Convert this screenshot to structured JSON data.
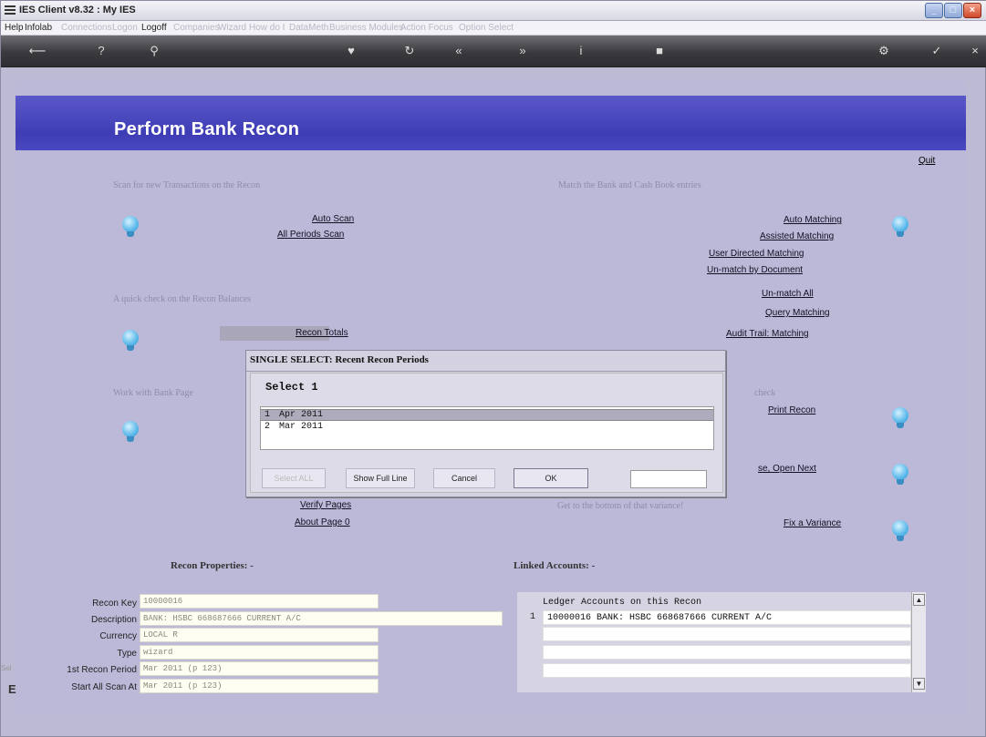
{
  "window": {
    "title": "IES Client v8.32 : My IES",
    "controls": {
      "minimize": "_",
      "maximize": "□",
      "close": "×"
    }
  },
  "menu": {
    "items": [
      {
        "label": "Help",
        "enabled": true
      },
      {
        "label": "Infolab",
        "enabled": true
      },
      {
        "label": "Connections",
        "enabled": false
      },
      {
        "label": "Logon",
        "enabled": false
      },
      {
        "label": "Logoff",
        "enabled": true
      },
      {
        "label": "Companies",
        "enabled": false
      },
      {
        "label": "Wizard",
        "enabled": false
      },
      {
        "label": "How do I",
        "enabled": false
      },
      {
        "label": "DataMeth",
        "enabled": false
      },
      {
        "label": "Business Modules",
        "enabled": false
      },
      {
        "label": "Action Focus",
        "enabled": false
      },
      {
        "label": "Option Select",
        "enabled": false
      }
    ]
  },
  "toolbar": {
    "icons": [
      "back-icon",
      "help-icon",
      "search-icon",
      "heart-icon",
      "refresh-icon",
      "rewind-icon",
      "forward-icon",
      "info-icon",
      "stop-icon",
      "settings-icon",
      "check-icon",
      "close-icon"
    ]
  },
  "page": {
    "title": "Perform Bank Recon",
    "quit": "Quit",
    "sections": {
      "scan": "Scan for new Transactions on the Recon",
      "match": "Match the Bank and Cash Book entries",
      "quick": "A quick check on the Recon Balances",
      "work": "Work with Bank Page",
      "check": "check",
      "variance": "Get to the bottom of that variance!"
    },
    "links": {
      "auto_scan": "Auto Scan",
      "all_periods_scan": "All Periods Scan",
      "auto_matching": "Auto Matching",
      "assisted_matching": "Assisted Matching",
      "user_directed_matching": "User Directed Matching",
      "unmatch_by_document": "Un-match by Document",
      "unmatch_all": "Un-match All",
      "query_matching": "Query Matching",
      "audit_trail_matching": "Audit Trail: Matching",
      "recon_totals": "Recon Totals",
      "print_recon": "Print Recon",
      "open_next": "se, Open Next",
      "verify_pages": "Verify Pages",
      "about_page_0": "About Page 0",
      "fix_variance": "Fix a Variance"
    }
  },
  "properties": {
    "heading": "Recon Properties: -",
    "fields": [
      {
        "label": "Recon Key",
        "value": "10000016"
      },
      {
        "label": "Description",
        "value": "BANK: HSBC 668687666 CURRENT A/C"
      },
      {
        "label": "Currency",
        "value": "LOCAL R"
      },
      {
        "label": "Type",
        "value": "wizard"
      },
      {
        "label": "1st Recon Period",
        "value": "Mar 2011 (p 123)"
      },
      {
        "label": "Start All Scan At",
        "value": "Mar 2011 (p 123)"
      }
    ]
  },
  "linked": {
    "heading": "Linked Accounts: -",
    "header": "Ledger Accounts on this Recon",
    "rows": [
      {
        "index": "1",
        "text": "10000016 BANK: HSBC 668687666 CURRENT A/C"
      }
    ]
  },
  "dialog": {
    "title": "SINGLE SELECT: Recent Recon Periods",
    "prompt": "Select 1",
    "items": [
      {
        "n": "1",
        "text": "Apr 2011"
      },
      {
        "n": "2",
        "text": "Mar 2011"
      }
    ],
    "selected_index": 0,
    "buttons": {
      "select_all": "Select ALL",
      "show_full_line": "Show Full Line",
      "cancel": "Cancel",
      "ok": "OK"
    },
    "ok_input": ""
  },
  "sidestub": {
    "top": "Sel",
    "bottom": "E"
  },
  "colors": {
    "banner": "#3e3db5",
    "background": "#bcb9d8",
    "bulb": "#5ab8ea"
  }
}
